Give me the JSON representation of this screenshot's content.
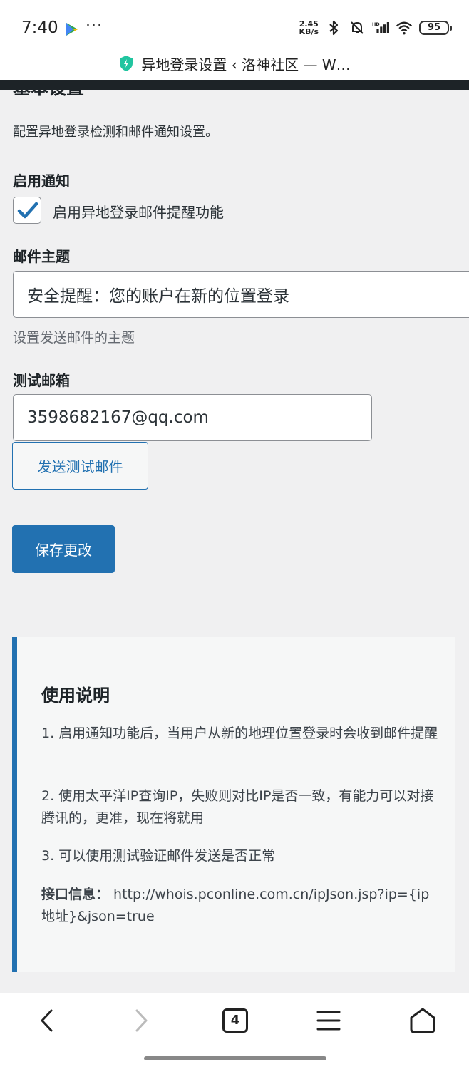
{
  "status_bar": {
    "time": "7:40",
    "more": "···",
    "net_speed_value": "2.45",
    "net_speed_unit": "KB/s",
    "hd_label": "HD",
    "battery": "95"
  },
  "browser": {
    "page_title": "异地登录设置 ‹ 洛神社区 — W…",
    "tab_count": "4"
  },
  "form": {
    "section_heading": "基本设置",
    "description": "配置异地登录检测和邮件通知设置。",
    "enable_label": "启用通知",
    "enable_checkbox_label": "启用异地登录邮件提醒功能",
    "enable_checked": true,
    "subject_label": "邮件主题",
    "subject_value": "安全提醒：您的账户在新的位置登录",
    "subject_hint": "设置发送邮件的主题",
    "test_email_label": "测试邮箱",
    "test_email_value": "3598682167@qq.com",
    "send_test_button": "发送测试邮件",
    "save_button": "保存更改"
  },
  "instructions": {
    "title": "使用说明",
    "item1": "1. 启用通知功能后，当用户从新的地理位置登录时会收到邮件提醒",
    "item2": "2. 使用太平洋IP查询IP，失败则对比IP是否一致，有能力可以对接腾讯的，更准，现在将就用",
    "item3": "3. 可以使用测试验证邮件发送是否正常",
    "api_label": "接口信息：",
    "api_url": " http://whois.pconline.com.cn/ipJson.jsp?ip={ip地址}&json=true"
  },
  "colors": {
    "primary": "#2271b1",
    "background": "#f0f0f1",
    "notice_bg": "#f6f7f7",
    "admin_bar": "#1d2327"
  },
  "icons": [
    "play-store-icon",
    "bluetooth-icon",
    "mute-icon",
    "signal-icon",
    "wifi-icon",
    "shield-icon",
    "check-icon",
    "back-icon",
    "forward-icon",
    "tabs-icon",
    "menu-icon",
    "home-icon"
  ]
}
